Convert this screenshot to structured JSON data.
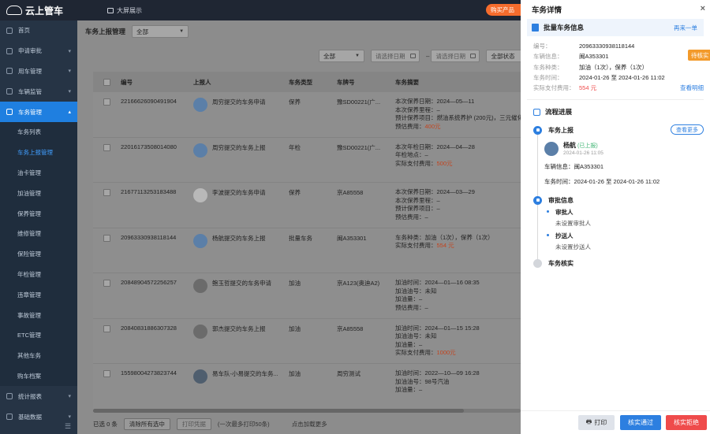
{
  "app": {
    "name": "云上管车",
    "bigscreen": "大屏展示",
    "buy_label": "购买产品"
  },
  "sidebar": {
    "items": [
      {
        "label": "首页"
      },
      {
        "label": "申请审批"
      },
      {
        "label": "用车管理"
      },
      {
        "label": "车辆监管"
      },
      {
        "label": "车务管理"
      },
      {
        "label": "车务列表"
      },
      {
        "label": "车务上报管理"
      },
      {
        "label": "油卡管理"
      },
      {
        "label": "加油管理"
      },
      {
        "label": "保养管理"
      },
      {
        "label": "维修管理"
      },
      {
        "label": "保险管理"
      },
      {
        "label": "年检管理"
      },
      {
        "label": "违章管理"
      },
      {
        "label": "事故管理"
      },
      {
        "label": "ETC管理"
      },
      {
        "label": "其他车务"
      },
      {
        "label": "购车档案"
      },
      {
        "label": "统计报表"
      },
      {
        "label": "基础数据"
      }
    ]
  },
  "main": {
    "title": "车务上报管理",
    "scope_select": "全部",
    "filter_all": "全部",
    "date_start_placeholder": "请选择日期",
    "date_end_placeholder": "请选择日期",
    "status_placeholder": "全部状态",
    "columns": [
      "编号",
      "上报人",
      "车务类型",
      "车牌号",
      "车务摘要"
    ],
    "rows": [
      {
        "no": "22166626090491904",
        "reporter": "周穷提交的车务申请",
        "type": "保养",
        "plate": "豫SD00221(广...",
        "s1": "本次保养日期：2024—05—11",
        "s2": "本次保养里程：–",
        "s3": "预计保养项目：燃油系统养护 (200元)，三元催化清...",
        "s4": "预估费用：",
        "s4v": "400元"
      },
      {
        "no": "22016173508014080",
        "reporter": "周穷提交的车务上报",
        "type": "年检",
        "plate": "豫SD00221(广...",
        "s1": "本次年检日期：2024—04—28",
        "s2": "年检地点：–",
        "s3": "实际支付费用：",
        "s3v": "500元"
      },
      {
        "no": "21677113253183488",
        "reporter": "李波提交的车务申请",
        "type": "保养",
        "plate": "京A85558",
        "s1": "本次保养日期：2024—03—29",
        "s2": "本次保养里程：–",
        "s3": "预计保养项目：–",
        "s4": "预估费用：–"
      },
      {
        "no": "20963330938118144",
        "reporter": "杨航提交的车务上报",
        "type": "批量车务",
        "plate": "闽A353301",
        "s1": "车务种类：加油（1次），保养（1次）",
        "s2": "实际支付费用：",
        "s2v": "554 元"
      },
      {
        "no": "20848904572256257",
        "reporter": "鲍玉哲提交的车务申请",
        "type": "加油",
        "plate": "京A123(奥迪A2)",
        "s1": "加油时间：2024—01—16 08:35",
        "s2": "加油油号：未知",
        "s3": "加油量：–",
        "s4": "预估费用：–"
      },
      {
        "no": "20840831886307328",
        "reporter": "郭杰提交的车务上报",
        "type": "加油",
        "plate": "京A85558",
        "s1": "加油时间：2024—01—15 15:28",
        "s2": "加油油号：未知",
        "s3": "加油量：–",
        "s4": "实际支付费用：",
        "s4v": "1000元"
      },
      {
        "no": "15598004273823744",
        "reporter": "易车队-小易提交的车务...",
        "type": "加油",
        "plate": "周穷测试",
        "s1": "加油时间：2022—10—09 16:28",
        "s2": "加油油号：98号汽油",
        "s3": "加油量：–"
      }
    ],
    "footer": {
      "selected": "已选 0 条",
      "clear": "清除所有选中",
      "print": "打印凭据",
      "print_hint": "(一次最多打印50条)",
      "load_more": "点击加载更多"
    }
  },
  "drawer": {
    "title": "车务详情",
    "card_title": "批量车务信息",
    "reapply": "再来一单",
    "status": "待核实",
    "info": [
      {
        "k": "编号：",
        "v": "20963330938118144"
      },
      {
        "k": "车辆信息：",
        "v": "闽A353301"
      },
      {
        "k": "车务种类：",
        "v": "加油（1次），保养（1次）"
      },
      {
        "k": "车务时间：",
        "v": "2024-01-26 至 2024-01-26 11:02"
      },
      {
        "k": "实际支付费用：",
        "v": "554 元"
      }
    ],
    "view_detail": "查看明细",
    "flow_title": "流程进展",
    "step1": "车务上报",
    "see_more": "查看更多",
    "person_name": "杨航",
    "person_tag": "(已上报)",
    "person_time": "2024-01-26 11:05",
    "vehicle_line": "车辆信息：闽A353301",
    "time_line": "车务时间：2024-01-26 至 2024-01-26 11:02",
    "step2": "审批信息",
    "approver_label": "审批人",
    "approver_value": "未设置审批人",
    "cc_label": "抄送人",
    "cc_value": "未设置抄送人",
    "step3": "车务核实",
    "btn_print": "打印",
    "btn_pass": "核实通过",
    "btn_reject": "核实拒绝"
  },
  "colors": {
    "primary": "#2d7fe0",
    "danger": "#ef4b4b",
    "warning": "#f39a2a",
    "sidebar": "#263445"
  }
}
